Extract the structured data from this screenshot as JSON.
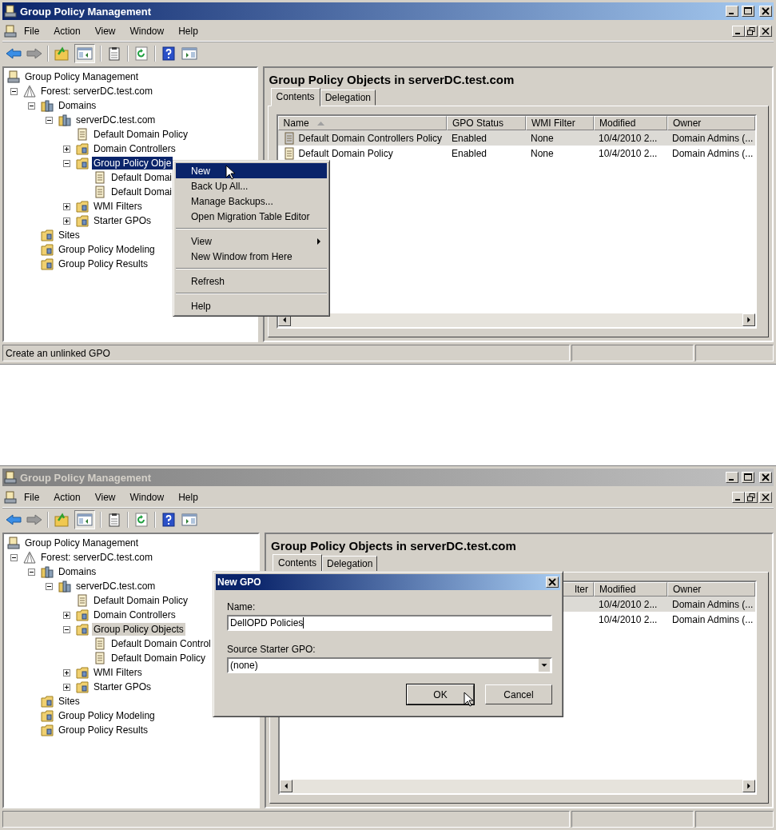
{
  "windows": [
    {
      "active": true,
      "title": "Group Policy Management",
      "menu": [
        "File",
        "Action",
        "View",
        "Window",
        "Help"
      ],
      "console_tree_button_on": true,
      "tree": [
        {
          "kind": "console",
          "label": "Group Policy Management",
          "selected": false,
          "children": [
            {
              "kind": "forest",
              "label": "Forest: serverDC.test.com",
              "selected": false,
              "expanded": true,
              "children": [
                {
                  "kind": "domains",
                  "label": "Domains",
                  "selected": false,
                  "expanded": true,
                  "children": [
                    {
                      "kind": "domain",
                      "label": "serverDC.test.com",
                      "selected": false,
                      "expanded": true,
                      "children": [
                        {
                          "kind": "link",
                          "label": "Default Domain Policy",
                          "selected": false
                        },
                        {
                          "kind": "folder",
                          "label": "Domain Controllers",
                          "selected": false,
                          "expanded": false
                        },
                        {
                          "kind": "folder",
                          "label": "Group Policy Obje",
                          "selected": true,
                          "expanded": true,
                          "children": [
                            {
                              "kind": "gpo",
                              "label": "Default Domai",
                              "selected": false
                            },
                            {
                              "kind": "gpo",
                              "label": "Default Domai",
                              "selected": false
                            }
                          ]
                        },
                        {
                          "kind": "folder",
                          "label": "WMI Filters",
                          "selected": false,
                          "expanded": false
                        },
                        {
                          "kind": "folder",
                          "label": "Starter GPOs",
                          "selected": false,
                          "expanded": false
                        }
                      ]
                    }
                  ]
                },
                {
                  "kind": "sites",
                  "label": "Sites",
                  "selected": false
                },
                {
                  "kind": "modeling",
                  "label": "Group Policy Modeling",
                  "selected": false
                },
                {
                  "kind": "results",
                  "label": "Group Policy Results",
                  "selected": false
                }
              ]
            }
          ]
        }
      ],
      "details": {
        "heading": "Group Policy Objects in serverDC.test.com",
        "tabs": [
          {
            "label": "Contents",
            "selected": true
          },
          {
            "label": "Delegation",
            "selected": false
          }
        ],
        "columns": [
          {
            "kind": "name",
            "label": "Name",
            "sorted": true,
            "cut_left": false
          },
          {
            "kind": "status",
            "label": "GPO Status",
            "sorted": false,
            "cut_left": false
          },
          {
            "kind": "filter",
            "label": "WMI Filter",
            "sorted": false,
            "cut_left": false
          },
          {
            "kind": "modified",
            "label": "Modified",
            "sorted": false,
            "cut_left": false
          },
          {
            "kind": "owner",
            "label": "Owner",
            "sorted": false,
            "cut_left": false
          }
        ],
        "rows": [
          {
            "selected": true,
            "cells": [
              "Default Domain Controllers Policy",
              "Enabled",
              "None",
              "10/4/2010 2...",
              "Domain Admins (..."
            ]
          },
          {
            "selected": false,
            "cells": [
              "Default Domain Policy",
              "Enabled",
              "None",
              "10/4/2010 2...",
              "Domain Admins (..."
            ]
          }
        ]
      },
      "status_bar": "Create an unlinked GPO",
      "context_menu": [
        {
          "kind": "item",
          "label": "New",
          "selected": true,
          "submenu": false
        },
        {
          "kind": "item",
          "label": "Back Up All...",
          "selected": false,
          "submenu": false
        },
        {
          "kind": "item",
          "label": "Manage Backups...",
          "selected": false,
          "submenu": false
        },
        {
          "kind": "item",
          "label": "Open Migration Table Editor",
          "selected": false,
          "submenu": false
        },
        {
          "kind": "separator"
        },
        {
          "kind": "item",
          "label": "View",
          "selected": false,
          "submenu": true
        },
        {
          "kind": "item",
          "label": "New Window from Here",
          "selected": false,
          "submenu": false
        },
        {
          "kind": "separator"
        },
        {
          "kind": "item",
          "label": "Refresh",
          "selected": false,
          "submenu": false
        },
        {
          "kind": "separator"
        },
        {
          "kind": "item",
          "label": "Help",
          "selected": false,
          "submenu": false
        }
      ]
    },
    {
      "active": false,
      "title": "Group Policy Management",
      "menu": [
        "File",
        "Action",
        "View",
        "Window",
        "Help"
      ],
      "console_tree_button_on": true,
      "tree": [
        {
          "kind": "console",
          "label": "Group Policy Management",
          "selected": false,
          "children": [
            {
              "kind": "forest",
              "label": "Forest: serverDC.test.com",
              "selected": false,
              "expanded": true,
              "children": [
                {
                  "kind": "domains",
                  "label": "Domains",
                  "selected": false,
                  "expanded": true,
                  "children": [
                    {
                      "kind": "domain",
                      "label": "serverDC.test.com",
                      "selected": false,
                      "expanded": true,
                      "children": [
                        {
                          "kind": "link",
                          "label": "Default Domain Policy",
                          "selected": false
                        },
                        {
                          "kind": "folder",
                          "label": "Domain Controllers",
                          "selected": false,
                          "expanded": false
                        },
                        {
                          "kind": "folder",
                          "label": "Group Policy Objects",
                          "selected": true,
                          "expanded": true,
                          "children": [
                            {
                              "kind": "gpo",
                              "label": "Default Domain Control",
                              "selected": false
                            },
                            {
                              "kind": "gpo",
                              "label": "Default Domain Policy",
                              "selected": false
                            }
                          ]
                        },
                        {
                          "kind": "folder",
                          "label": "WMI Filters",
                          "selected": false,
                          "expanded": false
                        },
                        {
                          "kind": "folder",
                          "label": "Starter GPOs",
                          "selected": false,
                          "expanded": false
                        }
                      ]
                    }
                  ]
                },
                {
                  "kind": "sites",
                  "label": "Sites",
                  "selected": false
                },
                {
                  "kind": "modeling",
                  "label": "Group Policy Modeling",
                  "selected": false
                },
                {
                  "kind": "results",
                  "label": "Group Policy Results",
                  "selected": false
                }
              ]
            }
          ]
        }
      ],
      "details": {
        "heading": "Group Policy Objects in serverDC.test.com",
        "tabs": [
          {
            "label": "Contents",
            "selected": true
          },
          {
            "label": "Delegation",
            "selected": false
          }
        ],
        "columns": [
          {
            "kind": "filter",
            "label": "lter",
            "sorted": false,
            "cut_left": true
          },
          {
            "kind": "modified",
            "label": "Modified",
            "sorted": false,
            "cut_left": false
          },
          {
            "kind": "owner",
            "label": "Owner",
            "sorted": false,
            "cut_left": false
          }
        ],
        "rows": [
          {
            "selected": true,
            "cells": [
              "",
              "10/4/2010 2...",
              "Domain Admins (..."
            ]
          },
          {
            "selected": false,
            "cells": [
              "",
              "10/4/2010 2...",
              "Domain Admins (..."
            ]
          }
        ]
      },
      "dialog": {
        "title": "New GPO",
        "fields": [
          {
            "kind": "text",
            "label": "Name:",
            "value": "DellOPD Policies"
          },
          {
            "kind": "select",
            "label": "Source Starter GPO:",
            "value": "(none)"
          }
        ],
        "buttons": [
          {
            "label": "OK",
            "default": true
          },
          {
            "label": "Cancel",
            "default": false
          }
        ]
      }
    }
  ]
}
